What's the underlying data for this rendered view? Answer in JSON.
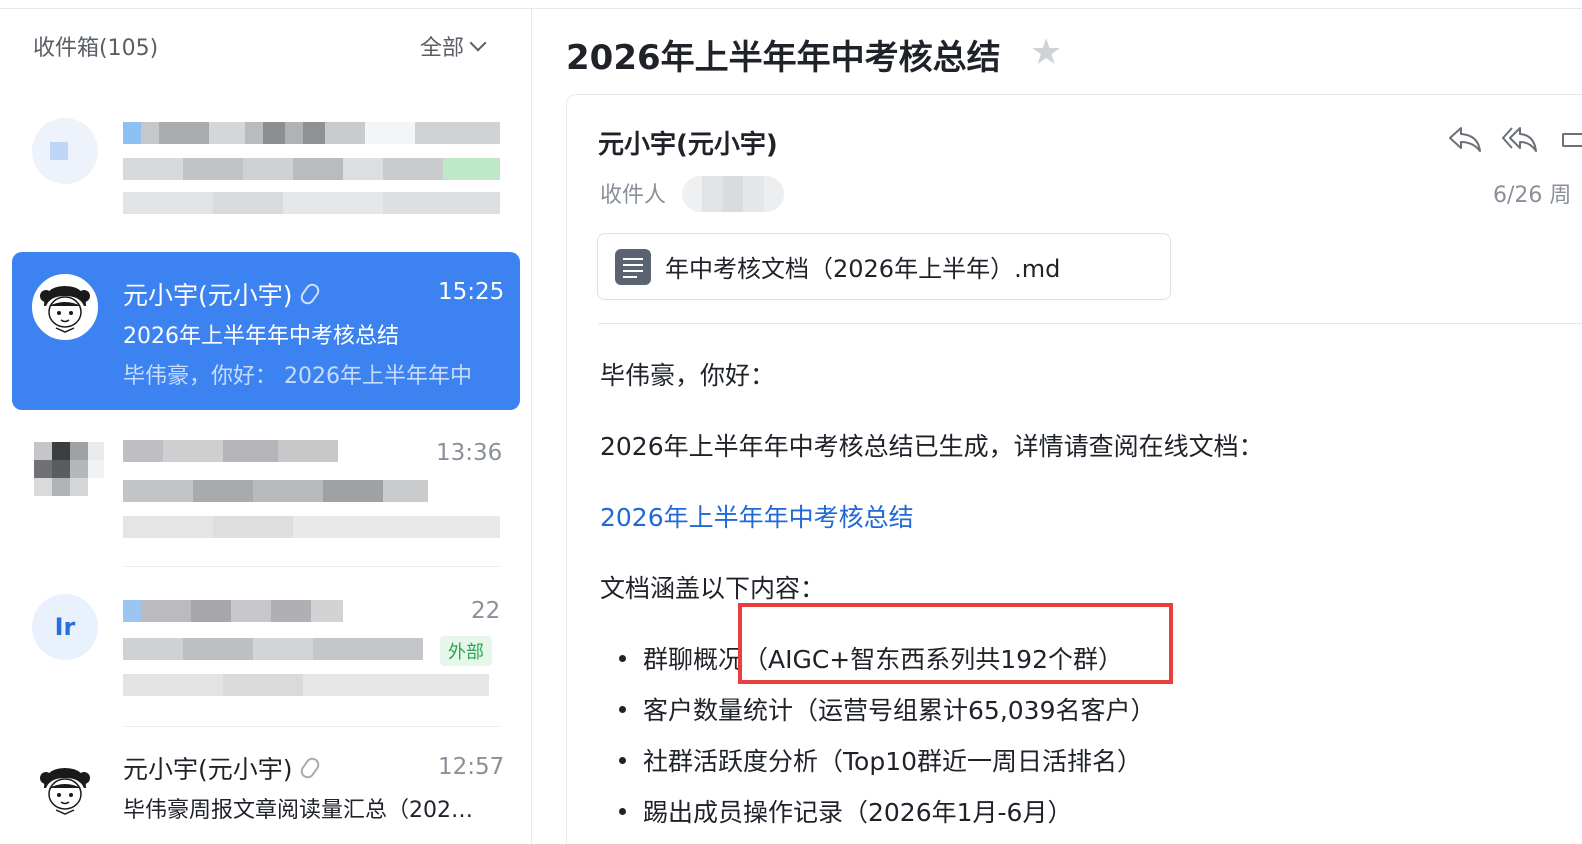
{
  "inbox": {
    "title": "收件箱(105)",
    "filter_label": "全部"
  },
  "list": [
    {
      "id": "blurred-1",
      "blurred": true
    },
    {
      "id": "selected",
      "sender": "元小宇(元小宇)",
      "time": "15:25",
      "subject": "2026年上半年年中考核总结",
      "preview": "毕伟豪，你好：  2026年上半年年中",
      "has_attachment": true
    },
    {
      "id": "blurred-2",
      "time": "13:36",
      "blurred": true
    },
    {
      "id": "blurred-3",
      "avatar_initials": "Ir",
      "time": "22",
      "tag": "外部",
      "blurred": true
    },
    {
      "id": "item-5",
      "sender": "元小宇(元小宇)",
      "time": "12:57",
      "subject": "毕伟豪周报文章阅读量汇总（202…",
      "has_attachment": true
    }
  ],
  "mail": {
    "title": "2026年上半年年中考核总结",
    "from": "元小宇(元小宇)",
    "recipient_label": "收件人",
    "date": "6/26 周",
    "attachment_name": "年中考核文档（2026年上半年）.md",
    "greeting": "毕伟豪，你好：",
    "intro": "2026年上半年年中考核总结已生成，详情请查阅在线文档：",
    "link_text": "2026年上半年年中考核总结",
    "covers_label": "文档涵盖以下内容：",
    "bullets": [
      "群聊概况（AIGC+智东西系列共192个群）",
      "客户数量统计（运营号组累计65,039名客户）",
      "社群活跃度分析（Top10群近一周日活排名）",
      "踢出成员操作记录（2026年1月-6月）"
    ]
  },
  "colors": {
    "accent": "#3c82f0",
    "link": "#2169d8",
    "highlight": "#ea3f3f",
    "external_tag": "#2ba74f"
  }
}
